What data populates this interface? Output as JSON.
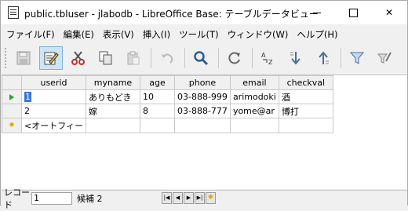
{
  "window": {
    "title": "public.tbluser - jlabodb - LibreOffice Base: テーブルデータビュー"
  },
  "menubar": {
    "items": [
      {
        "label": "ファイル(F)"
      },
      {
        "label": "編集(E)"
      },
      {
        "label": "表示(V)"
      },
      {
        "label": "挿入(I)"
      },
      {
        "label": "ツール(T)"
      },
      {
        "label": "ウィンドウ(W)"
      },
      {
        "label": "ヘルプ(H)"
      }
    ]
  },
  "toolbar": {
    "icons": [
      "save-icon",
      "edit-data-icon",
      "cut-icon",
      "copy-icon",
      "paste-icon",
      "undo-icon",
      "find-icon",
      "refresh-icon",
      "sort-icon",
      "sort-ascending-icon",
      "sort-descending-icon",
      "autofilter-icon",
      "standard-filter-icon"
    ]
  },
  "grid": {
    "columns": [
      "userid",
      "myname",
      "age",
      "phone",
      "email",
      "checkval"
    ],
    "rows": [
      {
        "userid": "1",
        "myname": "ありもどき",
        "age": "10",
        "phone": "03-888-999",
        "email": "arimodoki",
        "checkval": "酒"
      },
      {
        "userid": "2",
        "myname": "嫁",
        "age": "8",
        "phone": "03-888-777",
        "email": "yome@ar",
        "checkval": "博打"
      }
    ],
    "new_row_placeholder": "<オートフィー"
  },
  "statusbar": {
    "record_label": "レコード",
    "record_value": "1",
    "count_label": "候補 2"
  }
}
